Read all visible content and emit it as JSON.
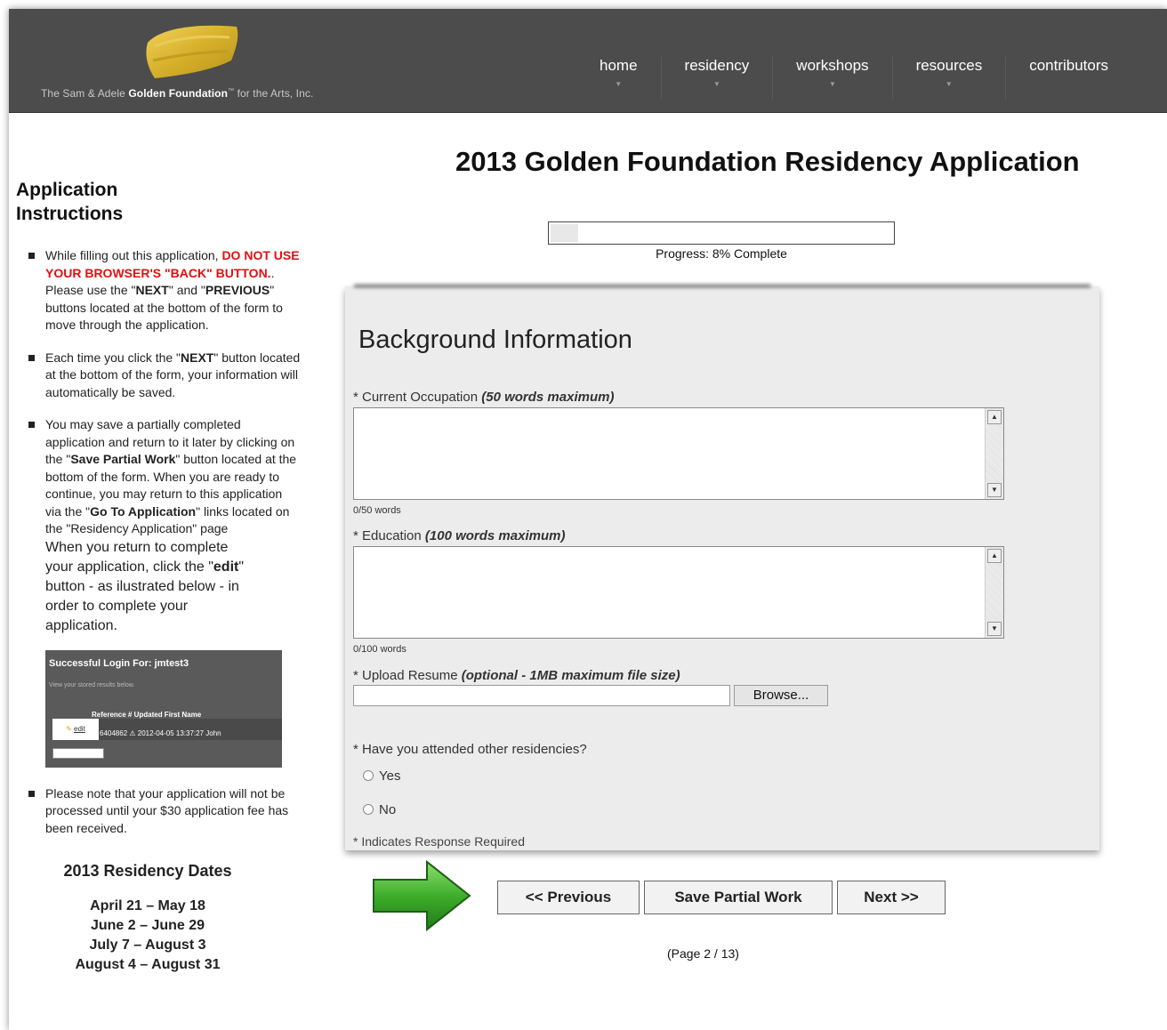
{
  "header": {
    "logo_prefix": "The Sam & Adele",
    "logo_bold": "Golden Foundation",
    "logo_tm": "™",
    "logo_suffix": "for the Arts, Inc.",
    "nav": [
      "home",
      "residency",
      "workshops",
      "resources",
      "contributors"
    ]
  },
  "sidebar": {
    "title_line1": "Application",
    "title_line2": "Instructions",
    "bullet1": {
      "a": "While filling out this application,",
      "red": "DO NOT USE YOUR BROWSER'S \"BACK\" BUTTON.",
      "b": ". Please use the \"",
      "next": "NEXT",
      "c": "\" and \"",
      "prev": "PREVIOUS",
      "d": "\" buttons located at the bottom of the form to move through the application."
    },
    "bullet2": {
      "a": "Each time you click the \"",
      "next": "NEXT",
      "b": "\" button located at the bottom of the form, your information will automatically be saved."
    },
    "bullet3": {
      "a": "You may save a partially completed application and return to it later by clicking on the \"",
      "save": "Save Partial Work",
      "b": "\" button located at the bottom of the form. When you are ready to continue, you may return to this application via the \"",
      "goto": "Go To Application",
      "c": "\" links located on the \"Residency Application\" page",
      "d": "When you return to complete your application, click the \"",
      "edit": "edit",
      "e": "\" button - as ilustrated below - in order to complete your application."
    },
    "login_example": {
      "title": "Successful Login For: jmtest3",
      "subtitle": "View your stored results below.",
      "columns": "Reference #        Updated              First Name",
      "edit": "edit",
      "row": "6404862  ⚠  2012-04-05 13:37:27  John"
    },
    "bullet4": "Please note that your application will not be processed until your $30 application fee has been received.",
    "dates_title": "2013 Residency Dates",
    "dates": [
      "April 21 – May 18",
      "June 2 – June 29",
      "July 7 – August 3",
      "August 4 – August 31"
    ]
  },
  "main": {
    "title": "2013 Golden Foundation Residency Application",
    "progress_text": "Progress: 8% Complete",
    "progress_fraction": 0.08,
    "section_title": "Background Information",
    "q1_label": "* Current Occupation",
    "q1_hint": "(50 words maximum)",
    "q1_count": "0/50 words",
    "q2_label": "* Education",
    "q2_hint": "(100 words maximum)",
    "q2_count": "0/100 words",
    "q3_label": "* Upload Resume",
    "q3_hint": "(optional - 1MB maximum file size)",
    "browse": "Browse...",
    "q4_label": "* Have you attended other residencies?",
    "opt_yes": "Yes",
    "opt_no": "No",
    "required_note": "* Indicates Response Required",
    "btn_prev": "<< Previous",
    "btn_save": "Save Partial Work",
    "btn_next": "Next >>",
    "page_counter": "(Page 2 / 13)"
  },
  "colors": {
    "header_bg": "#4c4c4c",
    "logo_gold": "#d9b52a",
    "warning_red": "#e01010",
    "arrow_green": "#3fae2a"
  }
}
